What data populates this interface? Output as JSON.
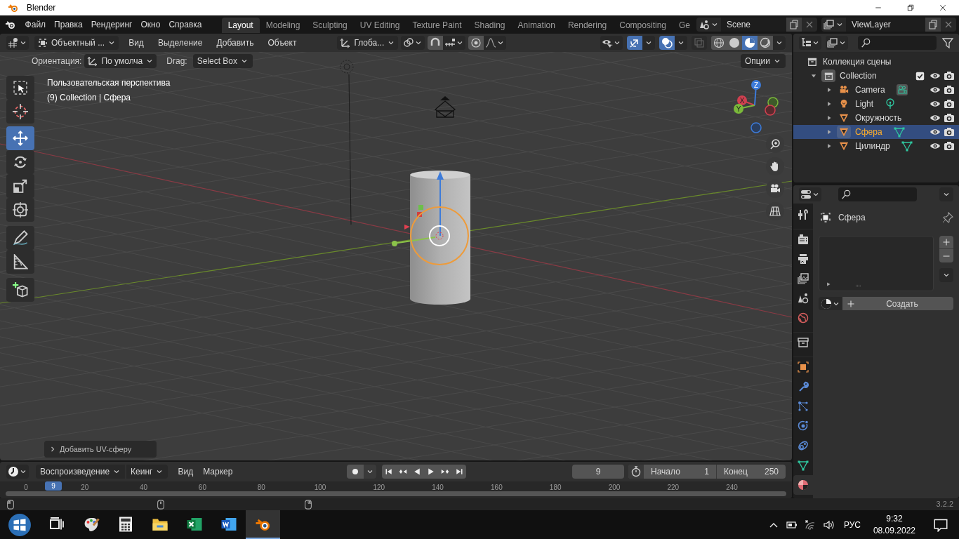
{
  "window": {
    "title": "Blender"
  },
  "menu": [
    "Файл",
    "Правка",
    "Рендеринг",
    "Окно",
    "Справка"
  ],
  "workspaces": [
    {
      "label": "Layout",
      "selected": true
    },
    {
      "label": "Modeling",
      "selected": false
    },
    {
      "label": "Sculpting",
      "selected": false
    },
    {
      "label": "UV Editing",
      "selected": false
    },
    {
      "label": "Texture Paint",
      "selected": false
    },
    {
      "label": "Shading",
      "selected": false
    },
    {
      "label": "Animation",
      "selected": false
    },
    {
      "label": "Rendering",
      "selected": false
    },
    {
      "label": "Compositing",
      "selected": false
    },
    {
      "label": "Ge",
      "selected": false
    }
  ],
  "scene": "Scene",
  "view_layer": "ViewLayer",
  "viewport_header": {
    "mode": "Объектный ...",
    "menus": [
      "Вид",
      "Выделение",
      "Добавить",
      "Объект"
    ],
    "transform": "Глоба...",
    "toggles": [
      {
        "kind": "gizmo",
        "on": true
      },
      {
        "kind": "overlay",
        "on": true
      },
      {
        "kind": "xray",
        "on": false
      }
    ],
    "shading": [
      {
        "kind": "wireframe",
        "selected": false
      },
      {
        "kind": "solid",
        "selected": false
      },
      {
        "kind": "material",
        "selected": true
      },
      {
        "kind": "rendered",
        "selected": false
      }
    ]
  },
  "tool_settings": {
    "orientation_label": "Ориентация:",
    "orientation": "По умолча",
    "drag_label": "Drag:",
    "drag": "Select Box",
    "options": "Опции"
  },
  "toolbar": [
    {
      "kind": "select",
      "selected": false
    },
    {
      "kind": "cursor",
      "selected": false
    },
    {
      "kind": "move",
      "selected": true
    },
    {
      "kind": "rotate",
      "selected": false
    },
    {
      "kind": "scale",
      "selected": false
    },
    {
      "kind": "transform",
      "selected": false
    },
    {
      "kind": "annotate",
      "selected": false
    },
    {
      "kind": "measure",
      "selected": false
    },
    {
      "kind": "add_cube",
      "selected": false
    }
  ],
  "viewport": {
    "overlay_lines": [
      "Пользовательская перспектива",
      "(9) Collection | Сфера"
    ],
    "gizmo_axes": [
      "X",
      "Y",
      "Z"
    ],
    "last_operator": "Добавить UV-сферу"
  },
  "outliner": {
    "root": "Коллекция сцены",
    "children": [
      {
        "label": "Collection",
        "kind": "collection",
        "expanded": true,
        "checked": true,
        "selected": false,
        "children": [
          {
            "label": "Camera",
            "kind": "camera",
            "expanded": false,
            "selected": false,
            "data": true
          },
          {
            "label": "Light",
            "kind": "light",
            "expanded": false,
            "selected": false,
            "data": true
          },
          {
            "label": "Окружность",
            "kind": "mesh",
            "expanded": false,
            "selected": false,
            "data": false
          },
          {
            "label": "Сфера",
            "kind": "mesh",
            "expanded": false,
            "selected": true,
            "data": true
          },
          {
            "label": "Цилиндр",
            "kind": "mesh",
            "expanded": false,
            "selected": false,
            "data": true
          }
        ]
      }
    ]
  },
  "properties": {
    "object": "Сфера",
    "create_button": "Создать",
    "tab_groups": [
      [
        {
          "kind": "tool",
          "selected": false
        }
      ],
      [
        {
          "kind": "render",
          "selected": false
        },
        {
          "kind": "output",
          "selected": false
        },
        {
          "kind": "view_layer",
          "selected": false
        },
        {
          "kind": "scene",
          "selected": false
        },
        {
          "kind": "world",
          "selected": false
        }
      ],
      [
        {
          "kind": "collection",
          "selected": false
        }
      ],
      [
        {
          "kind": "object",
          "selected": false
        },
        {
          "kind": "modifier",
          "selected": false
        },
        {
          "kind": "particles",
          "selected": false
        },
        {
          "kind": "physics",
          "selected": false
        },
        {
          "kind": "constraints",
          "selected": false
        },
        {
          "kind": "data",
          "selected": false
        },
        {
          "kind": "material",
          "selected": true
        }
      ]
    ]
  },
  "timeline": {
    "menus": [
      {
        "label": "Воспроизведение",
        "kind": "dropdown"
      },
      {
        "label": "Кеинг",
        "kind": "dropdown"
      },
      {
        "label": "Вид",
        "kind": "menu"
      },
      {
        "label": "Маркер",
        "kind": "menu"
      }
    ],
    "playback": [
      {
        "kind": "jump_start"
      },
      {
        "kind": "prev_key"
      },
      {
        "kind": "play_reverse"
      },
      {
        "kind": "play"
      },
      {
        "kind": "next_key"
      },
      {
        "kind": "jump_end"
      }
    ],
    "current_frame": "9",
    "start_label": "Начало",
    "start": "1",
    "end_label": "Конец",
    "end": "250",
    "playhead": "9",
    "ruler": [
      "0",
      "20",
      "40",
      "60",
      "80",
      "100",
      "120",
      "140",
      "160",
      "180",
      "200",
      "220",
      "240"
    ]
  },
  "status_bar": {
    "version": "3.2.2"
  },
  "taskbar": {
    "apps": [
      {
        "kind": "task_view",
        "selected": false
      },
      {
        "kind": "paint",
        "selected": false
      },
      {
        "kind": "calculator",
        "selected": false
      },
      {
        "kind": "explorer",
        "selected": false
      },
      {
        "kind": "excel",
        "selected": false
      },
      {
        "kind": "word",
        "selected": false
      },
      {
        "kind": "blender",
        "selected": true
      }
    ],
    "language": "РУС",
    "time": "9:32",
    "date": "08.09.2022"
  }
}
